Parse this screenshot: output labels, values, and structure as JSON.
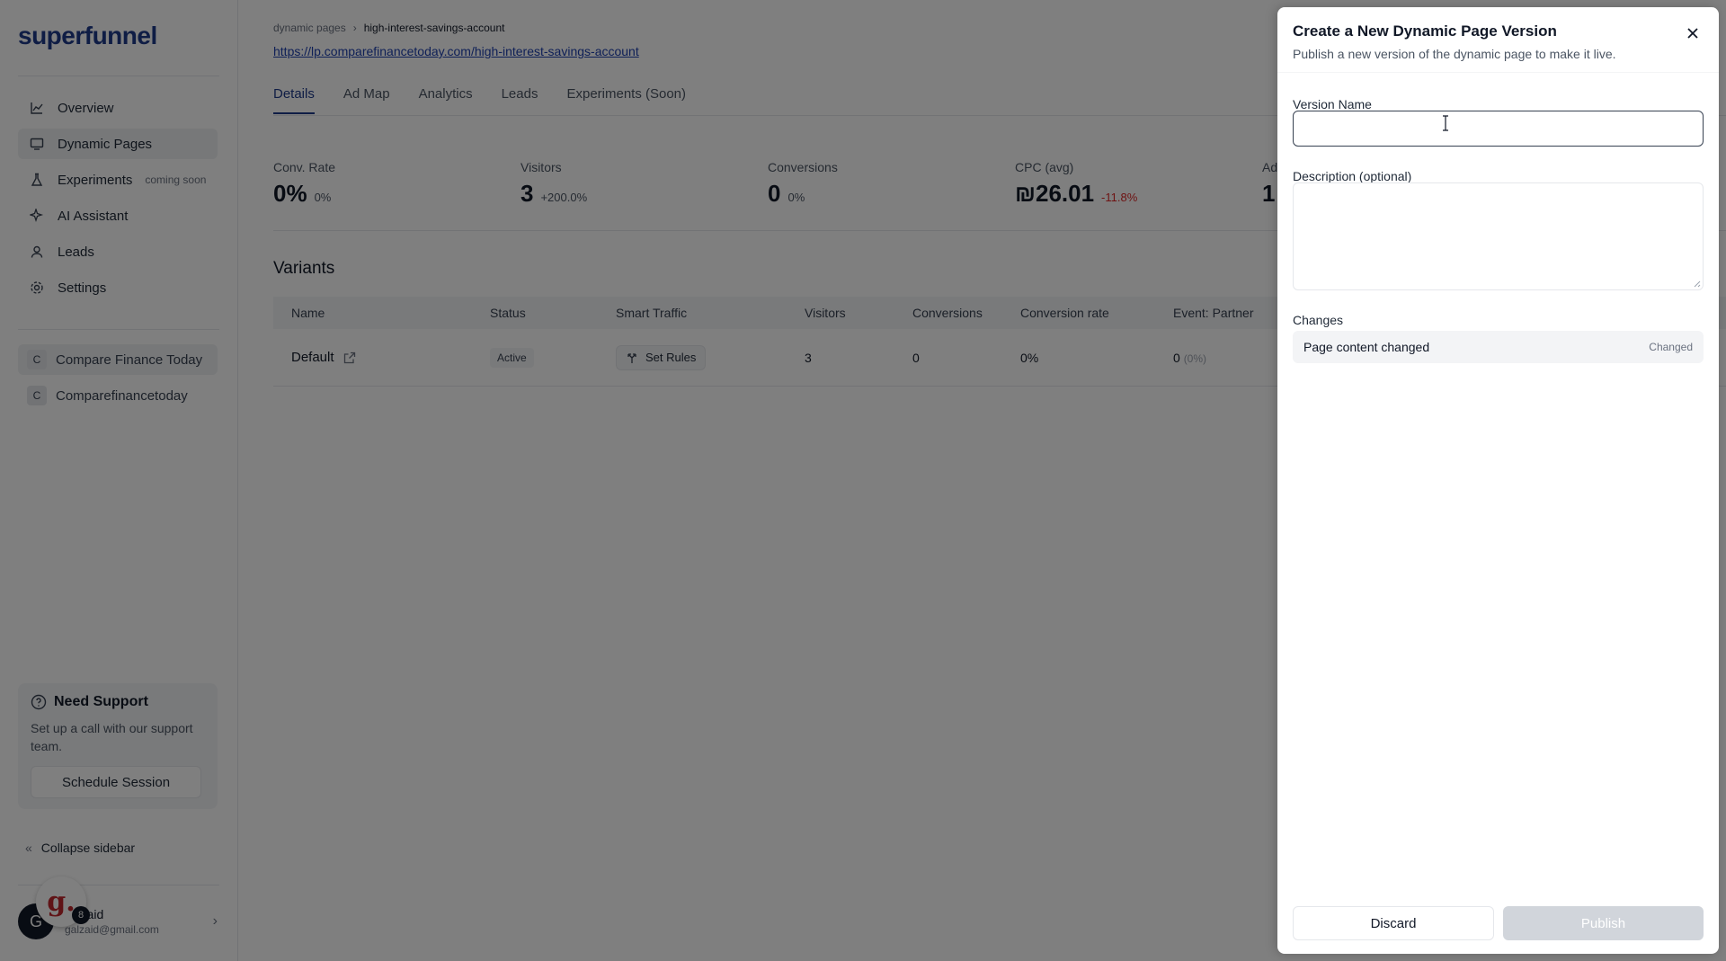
{
  "brand": {
    "logo": "superfunnel",
    "accent": "#1e3a8a"
  },
  "sidebar": {
    "nav": [
      {
        "label": "Overview",
        "icon": "chart-line-icon"
      },
      {
        "label": "Dynamic Pages",
        "icon": "monitor-icon"
      },
      {
        "label": "Experiments",
        "icon": "flask-icon",
        "badge": "coming soon"
      },
      {
        "label": "AI Assistant",
        "icon": "sparkle-icon"
      },
      {
        "label": "Leads",
        "icon": "user-icon"
      },
      {
        "label": "Settings",
        "icon": "gear-icon"
      }
    ],
    "workspaces": [
      {
        "initial": "C",
        "label": "Compare Finance Today"
      },
      {
        "initial": "C",
        "label": "Comparefinancetoday"
      }
    ],
    "support": {
      "title": "Need Support",
      "text": "Set up a call with our support team.",
      "button": "Schedule Session"
    },
    "collapse_label": "Collapse sidebar",
    "user": {
      "initial": "G",
      "name": "Zaid",
      "email": "galzaid@gmail.com"
    },
    "g_badge": {
      "letter": "g.",
      "count": "8"
    }
  },
  "main": {
    "breadcrumb": {
      "parent": "dynamic pages",
      "current": "high-interest-savings-account"
    },
    "page_url": "https://lp.comparefinancetoday.com/high-interest-savings-account",
    "tabs": [
      "Details",
      "Ad Map",
      "Analytics",
      "Leads",
      "Experiments (Soon)"
    ],
    "stats": [
      {
        "label": "Conv. Rate",
        "value": "0%",
        "delta": "0%"
      },
      {
        "label": "Visitors",
        "value": "3",
        "delta": "+200.0%"
      },
      {
        "label": "Conversions",
        "value": "0",
        "delta": "0%"
      },
      {
        "label": "CPC (avg)",
        "value": "₪26.01",
        "delta": "-11.8%"
      },
      {
        "label": "Ad",
        "value": "1",
        "delta": ""
      }
    ],
    "variants_title": "Variants",
    "table": {
      "headers": [
        "Name",
        "Status",
        "Smart Traffic",
        "Visitors",
        "Conversions",
        "Conversion rate",
        "Event: Partner"
      ],
      "rows": [
        {
          "name": "Default",
          "status": "Active",
          "smart_traffic": "Set Rules",
          "visitors": "3",
          "conversions": "0",
          "conversion_rate": "0%",
          "event": "0",
          "event_pct": "(0%)"
        }
      ]
    }
  },
  "drawer": {
    "title": "Create a New Dynamic Page Version",
    "subtitle": "Publish a new version of the dynamic page to make it live.",
    "version_label": "Version Name",
    "version_value": "",
    "description_label": "Description (optional)",
    "changes_label": "Changes",
    "changes": [
      {
        "text": "Page content changed",
        "tag": "Changed"
      }
    ],
    "discard": "Discard",
    "publish": "Publish"
  }
}
